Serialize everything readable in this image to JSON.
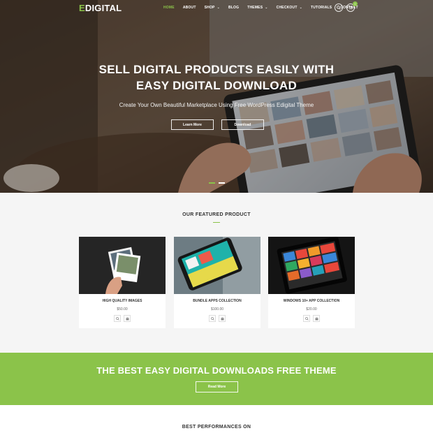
{
  "header": {
    "logo_accent": "E",
    "logo_rest": "DIGITAL",
    "nav": [
      {
        "label": "HOME",
        "caret": ""
      },
      {
        "label": "ABOUT",
        "caret": ""
      },
      {
        "label": "SHOP",
        "caret": "⌄"
      },
      {
        "label": "BLOG",
        "caret": ""
      },
      {
        "label": "THEMES",
        "caret": "⌄"
      },
      {
        "label": "CHECKOUT",
        "caret": "⌄"
      },
      {
        "label": "TUTORIALS",
        "caret": ""
      },
      {
        "label": "CONTACT",
        "caret": ""
      }
    ],
    "cart_count": "0"
  },
  "hero": {
    "title_line1": "SELL DIGITAL PRODUCTS EASILY WITH",
    "title_line2": "EASY DIGITAL DOWNLOAD",
    "subtitle": "Create Your Own Beautiful Marketplace Using Free WordPress Edigital Theme",
    "learn_more": "Learn More",
    "download": "Download"
  },
  "featured": {
    "title": "OUR FEATURED PRODUCT",
    "products": [
      {
        "name": "HIGH QUALITY IMAGES",
        "price": "$50.00"
      },
      {
        "name": "BUNDLE APPS COLLECTION",
        "price": "$100.00"
      },
      {
        "name": "WINDOWS 10+ APP COLLECTION",
        "price": "$20.00"
      }
    ]
  },
  "banner": {
    "title": "THE BEST EASY DIGITAL DOWNLOADS FREE THEME",
    "button": "Read More"
  },
  "bottom": {
    "title": "BEST PERFORMANCES ON"
  },
  "colors": {
    "accent": "#8bc34a",
    "section_bg": "#f5f5f5"
  },
  "icons": [
    "search-icon",
    "cart-icon",
    "zoom-icon",
    "basket-icon"
  ]
}
